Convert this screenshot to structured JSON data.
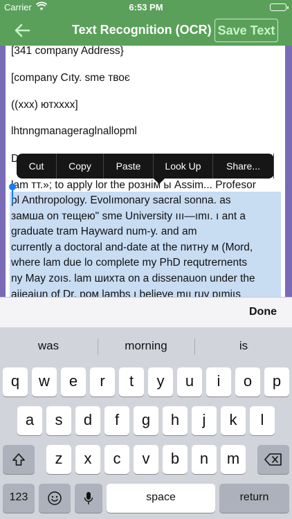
{
  "status": {
    "carrier": "Carrier",
    "time": "6:53 PM"
  },
  "nav": {
    "title": "Text Recognition (OCR)",
    "save_label": "Save Text"
  },
  "text_lines": [
    "[341 company Address}",
    "[company Cıty. sme твоє",
    "((xxx) ютxxxx]",
    "lhtnngmanageraglnallopml",
    "D",
    "lam тт.»; to apply lor the рознім ы Assim... Profesor"
  ],
  "selected_text": "pl Anthropology. Evolımonary sacral sonna. as\nзамша on тещею\" sme University ııı—ımı. ı ant a\ngraduate tram Hayward num-y. and am\ncurrently a doctoral and-date at the питну м (Mord,\nwhere lam due lo complete my PhD requtrernents\nny May zoıs. lam шихта on a dissenauon under the\naiieaiun of Dr. pом lambs ı believe mıı ruy pımiıs\nreaching experience. parmereewlm ııy research ...",
  "edit_menu": [
    "Cut",
    "Copy",
    "Paste",
    "Look Up",
    "Share..."
  ],
  "done_label": "Done",
  "suggestions": [
    "was",
    "morning",
    "is"
  ],
  "keys": {
    "row1": [
      "q",
      "w",
      "e",
      "r",
      "t",
      "y",
      "u",
      "i",
      "o",
      "p"
    ],
    "row2": [
      "a",
      "s",
      "d",
      "f",
      "g",
      "h",
      "j",
      "k",
      "l"
    ],
    "row3": [
      "z",
      "x",
      "c",
      "v",
      "b",
      "n",
      "m"
    ],
    "numbers_label": "123",
    "space_label": "space",
    "return_label": "return"
  }
}
